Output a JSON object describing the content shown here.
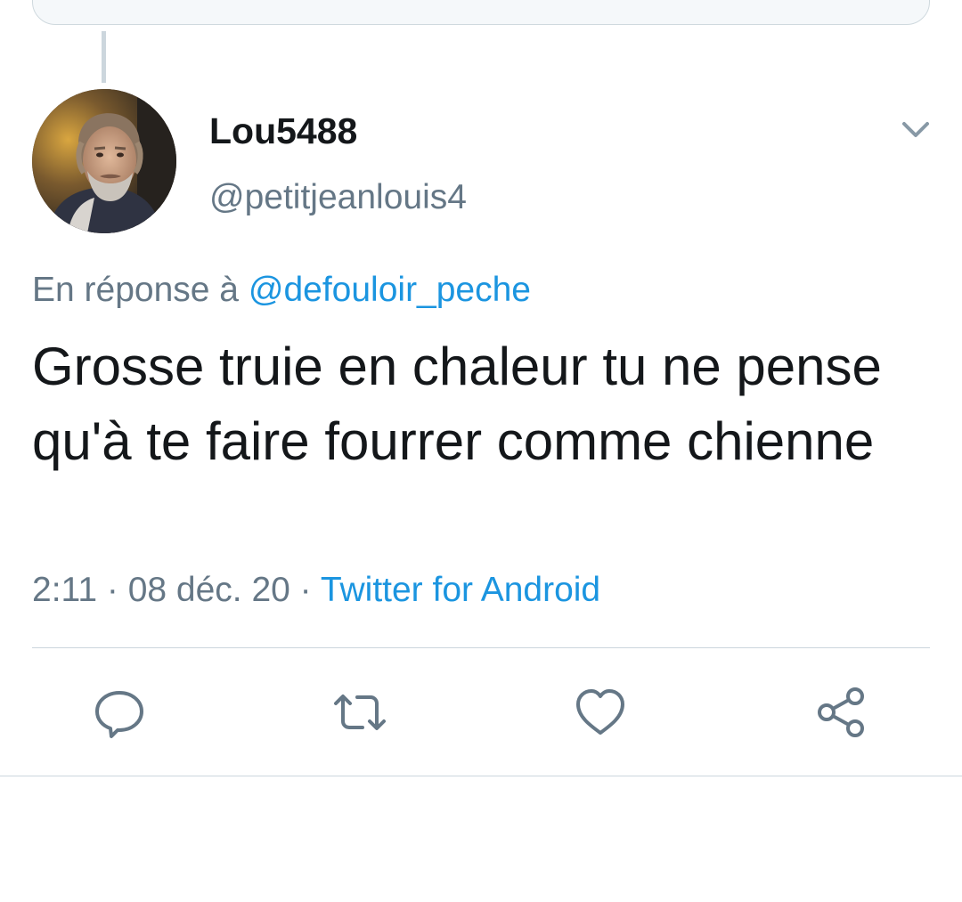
{
  "tweet": {
    "display_name": "Lou5488",
    "handle": "@petitjeanlouis4",
    "reply_prefix": "En réponse à",
    "reply_mention": "@defouloir_peche",
    "text": "Grosse truie en chaleur tu ne pense qu'à te faire fourrer comme chienne",
    "time": "2:11",
    "separator": " · ",
    "date": "08 déc. 20",
    "source": "Twitter for Android"
  },
  "icons": {
    "more": "chevron-down-icon",
    "reply": "reply-icon",
    "retweet": "retweet-icon",
    "like": "heart-icon",
    "share": "share-icon"
  },
  "colors": {
    "text_primary": "#14171a",
    "text_secondary": "#657786",
    "accent": "#1b95e0",
    "divider": "#ccd6dd",
    "icon": "#657786"
  }
}
